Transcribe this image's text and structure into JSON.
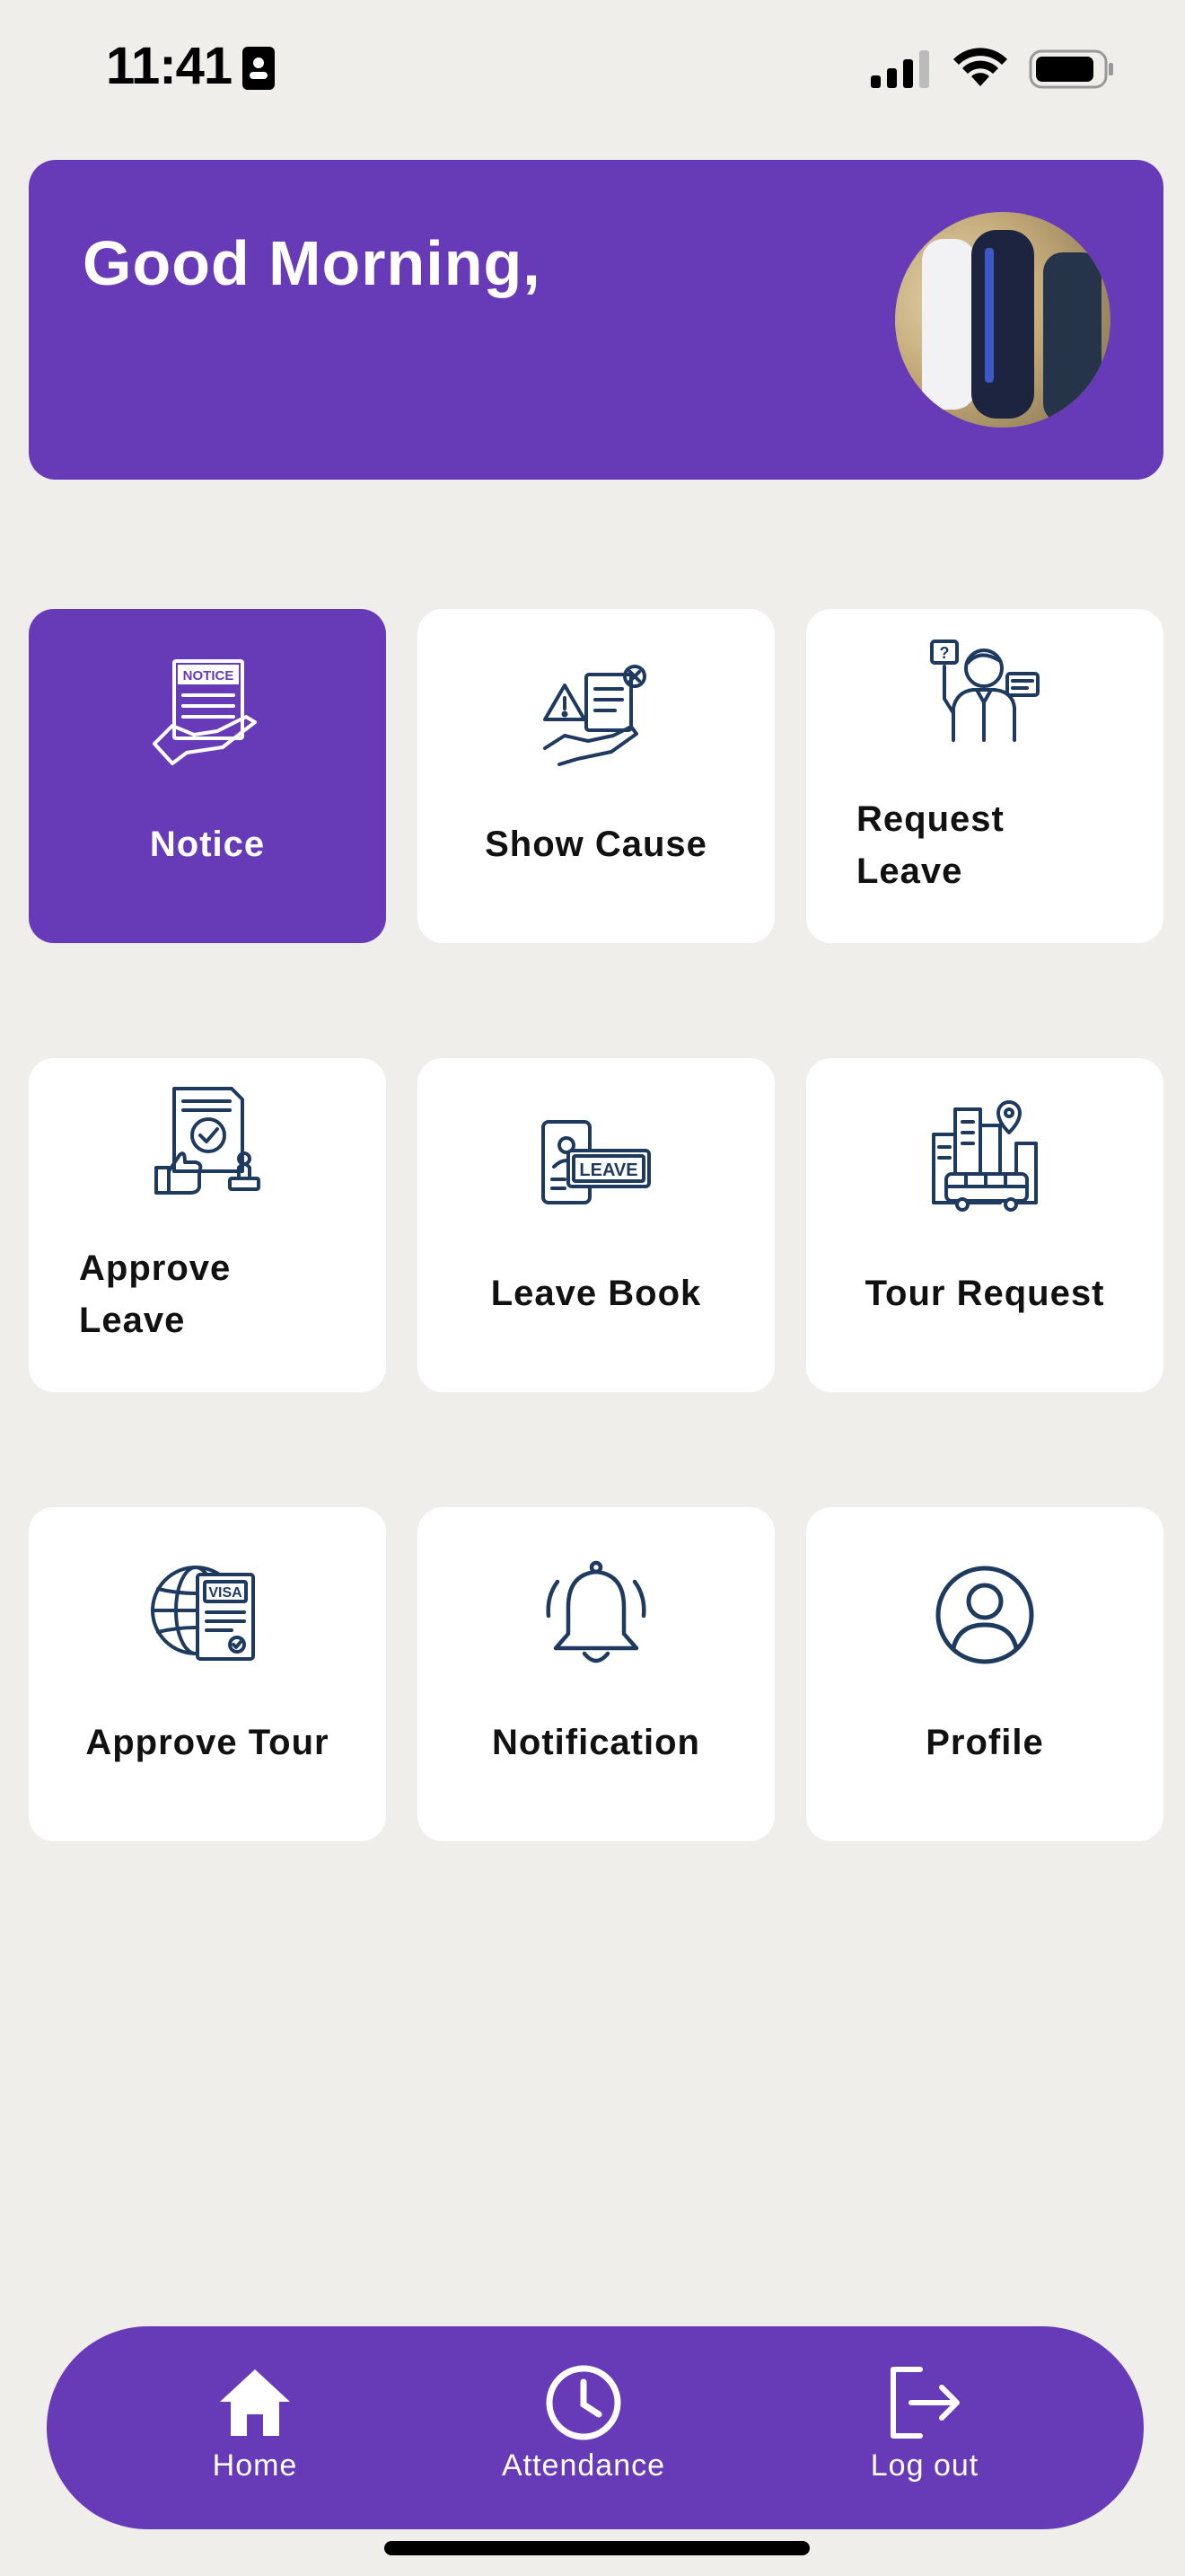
{
  "status_bar": {
    "time": "11:41"
  },
  "header": {
    "greeting": "Good Morning,"
  },
  "tiles": [
    {
      "label": "Notice",
      "icon": "notice-icon",
      "active": true
    },
    {
      "label": "Show Cause",
      "icon": "show-cause-icon",
      "active": false
    },
    {
      "label": "Request Leave",
      "icon": "request-leave-icon",
      "active": false
    },
    {
      "label": "Approve Leave",
      "icon": "approve-leave-icon",
      "active": false
    },
    {
      "label": "Leave Book",
      "icon": "leave-book-icon",
      "active": false
    },
    {
      "label": "Tour Request",
      "icon": "tour-request-icon",
      "active": false
    },
    {
      "label": "Approve Tour",
      "icon": "approve-tour-icon",
      "active": false
    },
    {
      "label": "Notification",
      "icon": "bell-icon",
      "active": false
    },
    {
      "label": "Profile",
      "icon": "profile-icon",
      "active": false
    }
  ],
  "tile_texts": {
    "notice_badge": "NOTICE",
    "leave_badge": "LEAVE",
    "visa_badge": "VISA",
    "request_leave_line1": "Request",
    "request_leave_line2": "Leave",
    "approve_leave_line1": "Approve",
    "approve_leave_line2": "Leave"
  },
  "bottom_nav": [
    {
      "label": "Home",
      "icon": "home-icon"
    },
    {
      "label": "Attendance",
      "icon": "clock-icon"
    },
    {
      "label": "Log out",
      "icon": "logout-icon"
    }
  ],
  "colors": {
    "accent": "#673ab7",
    "background": "#efeeeb",
    "icon_stroke": "#1f3a5f"
  }
}
